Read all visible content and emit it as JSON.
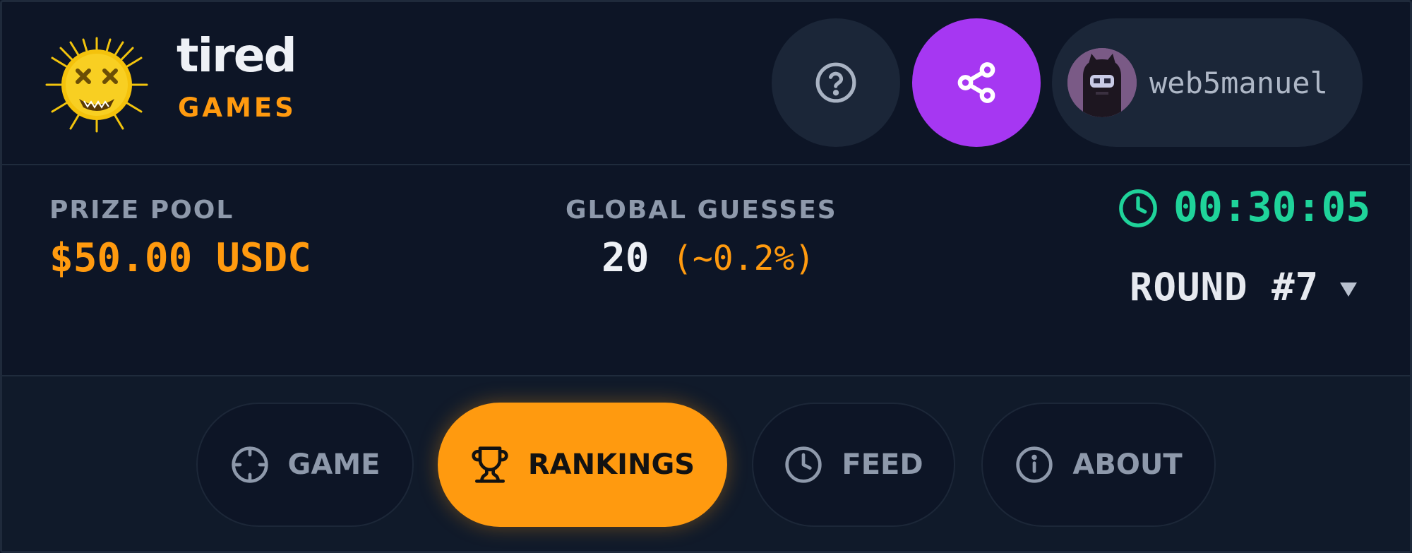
{
  "brand": {
    "name_top": "tired",
    "name_bottom": "GAMES",
    "logo_icon": "spiky-creature-logo"
  },
  "header": {
    "help_icon": "question-circle-icon",
    "share_icon": "share-icon",
    "user": {
      "username": "web5manuel",
      "avatar_icon": "user-avatar"
    }
  },
  "stats": {
    "prize_pool": {
      "label": "PRIZE POOL",
      "value": "$50.00 USDC"
    },
    "global_guesses": {
      "label": "GLOBAL GUESSES",
      "count": "20",
      "percent": "(~0.2%)"
    },
    "timer": {
      "value": "00:30:05",
      "icon": "clock-icon"
    },
    "round": {
      "label": "ROUND #7",
      "icon": "caret-down-icon"
    }
  },
  "nav": {
    "tabs": [
      {
        "label": "GAME",
        "icon": "crosshair-icon",
        "active": false
      },
      {
        "label": "RANKINGS",
        "icon": "trophy-icon",
        "active": true
      },
      {
        "label": "FEED",
        "icon": "clock-icon",
        "active": false
      },
      {
        "label": "ABOUT",
        "icon": "info-circle-icon",
        "active": false
      }
    ]
  },
  "colors": {
    "background": "#0d1526",
    "accent_orange": "#ff9a0f",
    "share_purple": "#a637f2",
    "timer_green": "#1fd39a",
    "button_dark": "#1b2638",
    "muted_text": "#8e99ab"
  }
}
